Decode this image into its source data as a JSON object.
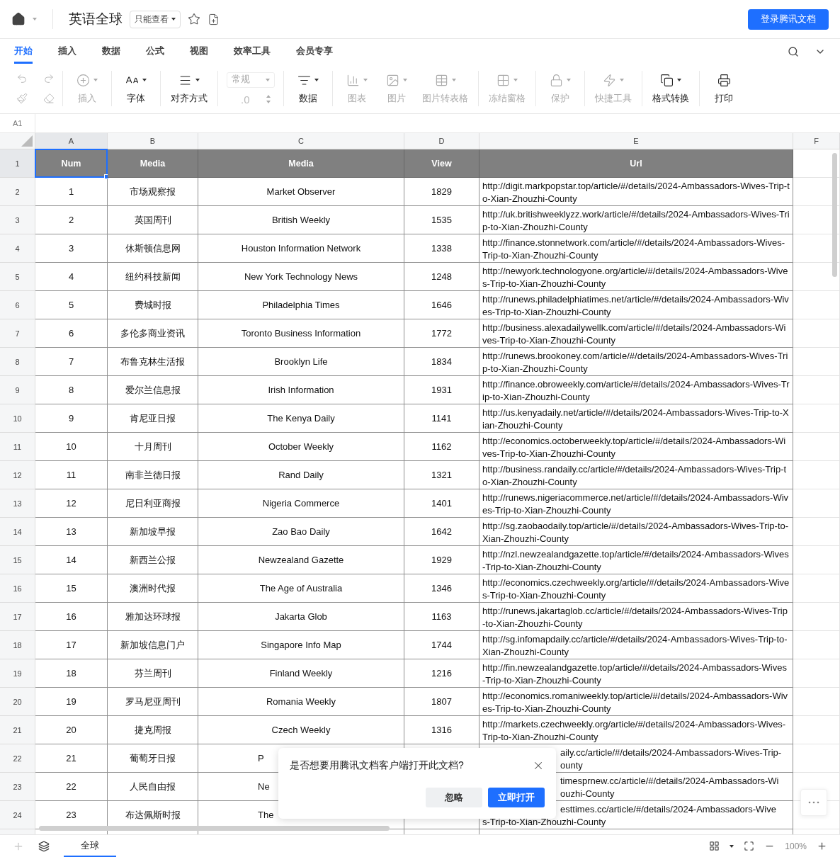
{
  "header": {
    "title": "英语全球",
    "permission": "只能查看",
    "login_button": "登录腾讯文档"
  },
  "tabs": [
    {
      "label": "开始",
      "selected": true
    },
    {
      "label": "插入",
      "selected": false
    },
    {
      "label": "数据",
      "selected": false
    },
    {
      "label": "公式",
      "selected": false
    },
    {
      "label": "视图",
      "selected": false
    },
    {
      "label": "效率工具",
      "selected": false
    },
    {
      "label": "会员专享",
      "selected": false
    }
  ],
  "history_tools": [
    {
      "disabled": true
    },
    {
      "disabled": true
    },
    {
      "disabled": true
    },
    {
      "disabled": true
    }
  ],
  "tool_groups": [
    [
      {
        "kind": "button",
        "label": "插入",
        "disabled": true
      }
    ],
    [
      {
        "kind": "button",
        "label": "字体",
        "disabled": false
      }
    ],
    [
      {
        "kind": "button",
        "label": "对齐方式",
        "disabled": false
      }
    ],
    [
      {
        "kind": "number-format",
        "value": "常规",
        "decimals": ".0",
        "disabled": true
      }
    ],
    [
      {
        "kind": "button",
        "label": "数据",
        "disabled": false
      }
    ],
    [
      {
        "kind": "button",
        "label": "图表",
        "disabled": true
      },
      {
        "kind": "button",
        "label": "图片",
        "disabled": true
      },
      {
        "kind": "button",
        "label": "图片转表格",
        "disabled": true
      }
    ],
    [
      {
        "kind": "button",
        "label": "冻结窗格",
        "disabled": true
      }
    ],
    [
      {
        "kind": "button",
        "label": "保护",
        "disabled": true
      }
    ],
    [
      {
        "kind": "button",
        "label": "快捷工具",
        "disabled": true
      }
    ],
    [
      {
        "kind": "button",
        "label": "格式转换",
        "disabled": false
      }
    ],
    [
      {
        "kind": "button",
        "label": "打印",
        "disabled": false
      }
    ]
  ],
  "name_box": "A1",
  "columns": [
    {
      "label": "A",
      "selected": true
    },
    {
      "label": "B",
      "selected": false
    },
    {
      "label": "C",
      "selected": false
    },
    {
      "label": "D",
      "selected": false
    },
    {
      "label": "E",
      "selected": false
    },
    {
      "label": "F",
      "selected": false
    }
  ],
  "header_row": {
    "row_number": "1",
    "selected": true,
    "cells": [
      "Num",
      "Media",
      "Media",
      "View",
      "Url"
    ]
  },
  "rows": [
    {
      "row_number": "2",
      "selected": false,
      "covered": false,
      "num": "1",
      "media_cn": "市场观察报",
      "media_en": "Market Observer",
      "views": "1829",
      "url": "http://digit.markpopstar.top/article/#/details/2024-Ambassadors-Wives-Trip-to-Xian-Zhouzhi-County"
    },
    {
      "row_number": "3",
      "selected": false,
      "covered": false,
      "num": "2",
      "media_cn": "英国周刊",
      "media_en": "British Weekly",
      "views": "1535",
      "url": "http://uk.britishweeklyzz.work/article/#/details/2024-Ambassadors-Wives-Trip-to-Xian-Zhouzhi-County"
    },
    {
      "row_number": "4",
      "selected": false,
      "covered": false,
      "num": "3",
      "media_cn": "休斯顿信息网",
      "media_en": "Houston Information Network",
      "views": "1338",
      "url": "http://finance.stonnetwork.com/article/#/details/2024-Ambassadors-Wives-Trip-to-Xian-Zhouzhi-County"
    },
    {
      "row_number": "5",
      "selected": false,
      "covered": false,
      "num": "4",
      "media_cn": "纽约科技新闻",
      "media_en": "New York Technology News",
      "views": "1248",
      "url": "http://newyork.technologyone.org/article/#/details/2024-Ambassadors-Wives-Trip-to-Xian-Zhouzhi-County"
    },
    {
      "row_number": "6",
      "selected": false,
      "covered": false,
      "num": "5",
      "media_cn": "费城时报",
      "media_en": "Philadelphia Times",
      "views": "1646",
      "url": "http://runews.philadelphiatimes.net/article/#/details/2024-Ambassadors-Wives-Trip-to-Xian-Zhouzhi-County"
    },
    {
      "row_number": "7",
      "selected": false,
      "covered": false,
      "num": "6",
      "media_cn": "多伦多商业资讯",
      "media_en": "Toronto Business Information",
      "views": "1772",
      "url": "http://business.alexadailywellk.com/article/#/details/2024-Ambassadors-Wives-Trip-to-Xian-Zhouzhi-County"
    },
    {
      "row_number": "8",
      "selected": false,
      "covered": false,
      "num": "7",
      "media_cn": "布鲁克林生活报",
      "media_en": "Brooklyn Life",
      "views": "1834",
      "url": "http://runews.brookoney.com/article/#/details/2024-Ambassadors-Wives-Trip-to-Xian-Zhouzhi-County"
    },
    {
      "row_number": "9",
      "selected": false,
      "covered": false,
      "num": "8",
      "media_cn": "爱尔兰信息报",
      "media_en": "Irish Information",
      "views": "1931",
      "url": "http://finance.obroweekly.com/article/#/details/2024-Ambassadors-Wives-Trip-to-Xian-Zhouzhi-County"
    },
    {
      "row_number": "10",
      "selected": false,
      "covered": false,
      "num": "9",
      "media_cn": "肯尼亚日报",
      "media_en": "The Kenya Daily",
      "views": "1141",
      "url": "http://us.kenyadaily.net/article/#/details/2024-Ambassadors-Wives-Trip-to-Xian-Zhouzhi-County"
    },
    {
      "row_number": "11",
      "selected": false,
      "covered": false,
      "num": "10",
      "media_cn": "十月周刊",
      "media_en": "October Weekly",
      "views": "1162",
      "url": "http://economics.octoberweekly.top/article/#/details/2024-Ambassadors-Wives-Trip-to-Xian-Zhouzhi-County"
    },
    {
      "row_number": "12",
      "selected": false,
      "covered": false,
      "num": "11",
      "media_cn": "南非兰德日报",
      "media_en": "Rand Daily",
      "views": "1321",
      "url": "http://business.randaily.cc/article/#/details/2024-Ambassadors-Wives-Trip-to-Xian-Zhouzhi-County"
    },
    {
      "row_number": "13",
      "selected": false,
      "covered": false,
      "num": "12",
      "media_cn": "尼日利亚商报",
      "media_en": "Nigeria Commerce",
      "views": "1401",
      "url": "http://runews.nigeriacommerce.net/article/#/details/2024-Ambassadors-Wives-Trip-to-Xian-Zhouzhi-County"
    },
    {
      "row_number": "14",
      "selected": false,
      "covered": false,
      "num": "13",
      "media_cn": "新加坡早报",
      "media_en": "Zao Bao Daily",
      "views": "1642",
      "url": "http://sg.zaobaodaily.top/article/#/details/2024-Ambassadors-Wives-Trip-to-Xian-Zhouzhi-County"
    },
    {
      "row_number": "15",
      "selected": false,
      "covered": false,
      "num": "14",
      "media_cn": "新西兰公报",
      "media_en": "Newzealand Gazette",
      "views": "1929",
      "url": "http://nzl.newzealandgazette.top/article/#/details/2024-Ambassadors-Wives-Trip-to-Xian-Zhouzhi-County"
    },
    {
      "row_number": "16",
      "selected": false,
      "covered": false,
      "num": "15",
      "media_cn": "澳洲时代报",
      "media_en": "The Age of Australia",
      "views": "1346",
      "url": "http://economics.czechweekly.org/article/#/details/2024-Ambassadors-Wives-Trip-to-Xian-Zhouzhi-County"
    },
    {
      "row_number": "17",
      "selected": false,
      "covered": false,
      "num": "16",
      "media_cn": "雅加达环球报",
      "media_en": "Jakarta Glob",
      "views": "1163",
      "url": "http://runews.jakartaglob.cc/article/#/details/2024-Ambassadors-Wives-Trip-to-Xian-Zhouzhi-County"
    },
    {
      "row_number": "18",
      "selected": false,
      "covered": false,
      "num": "17",
      "media_cn": "新加坡信息门户",
      "media_en": "Singapore Info Map",
      "views": "1744",
      "url": "http://sg.infomapdaily.cc/article/#/details/2024-Ambassadors-Wives-Trip-to-Xian-Zhouzhi-County"
    },
    {
      "row_number": "19",
      "selected": false,
      "covered": false,
      "num": "18",
      "media_cn": "芬兰周刊",
      "media_en": "Finland Weekly",
      "views": "1216",
      "url": "http://fin.newzealandgazette.top/article/#/details/2024-Ambassadors-Wives-Trip-to-Xian-Zhouzhi-County"
    },
    {
      "row_number": "20",
      "selected": false,
      "covered": false,
      "num": "19",
      "media_cn": "罗马尼亚周刊",
      "media_en": "Romania Weekly",
      "views": "1807",
      "url": "http://economics.romaniweekly.top/article/#/details/2024-Ambassadors-Wives-Trip-to-Xian-Zhouzhi-County"
    },
    {
      "row_number": "21",
      "selected": false,
      "covered": false,
      "num": "20",
      "media_cn": "捷克周报",
      "media_en": "Czech Weekly",
      "views": "1316",
      "url": "http://markets.czechweekly.org/article/#/details/2024-Ambassadors-Wives-Trip-to-Xian-Zhouzhi-County"
    },
    {
      "row_number": "22",
      "selected": false,
      "covered": true,
      "num": "21",
      "media_cn": "葡萄牙日报",
      "media_en": "P",
      "url_lines": [
        {
          "text": "aily.cc/article/#/details/2024-Ambassadors-Wives-Trip-",
          "clipped": true
        },
        {
          "text": "ounty",
          "clipped": true
        }
      ]
    },
    {
      "row_number": "23",
      "selected": false,
      "covered": true,
      "num": "22",
      "media_cn": "人民自由报",
      "media_en": "Ne",
      "url_lines": [
        {
          "text": "timesprnew.cc/article/#/details/2024-Ambassadors-Wi",
          "clipped": true
        },
        {
          "text": "ouzhi-County",
          "clipped": true
        }
      ]
    },
    {
      "row_number": "24",
      "selected": false,
      "covered": true,
      "num": "23",
      "media_cn": "布达佩斯时报",
      "media_en": "The",
      "url_lines": [
        {
          "text": "esttimes.cc/article/#/details/2024-Ambassadors-Wive",
          "clipped": true
        },
        {
          "text": "s-Trip-to-Xian-Zhouzhi-County",
          "clipped": false
        }
      ]
    }
  ],
  "dialog": {
    "message": "是否想要用腾讯文档客户端打开此文档?",
    "buttons": [
      {
        "label": "忽略",
        "primary": false
      },
      {
        "label": "立即打开",
        "primary": true
      }
    ]
  },
  "sheet_tabs": [
    {
      "label": "全球",
      "selected": true
    }
  ],
  "zoom": "100%"
}
